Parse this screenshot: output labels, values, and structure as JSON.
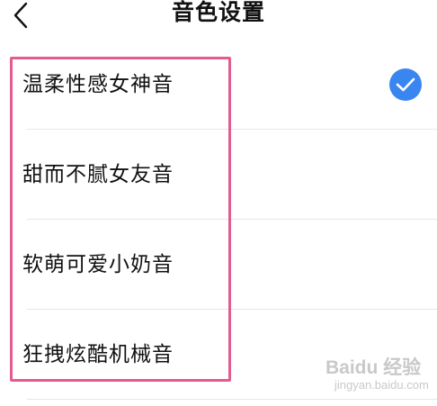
{
  "header": {
    "title": "音色设置"
  },
  "voices": [
    {
      "label": "温柔性感女神音",
      "selected": true
    },
    {
      "label": "甜而不腻女友音",
      "selected": false
    },
    {
      "label": "软萌可爱小奶音",
      "selected": false
    },
    {
      "label": "狂拽炫酷机械音",
      "selected": false
    }
  ],
  "colors": {
    "check": "#3a86f0",
    "highlight": "#e45c8f",
    "divider": "#e6e6e6"
  },
  "icons": {
    "back": "chevron-left-icon",
    "selected": "check-circle-icon"
  },
  "watermark": {
    "logo": "Baidu 经验",
    "url": "jingyan.baidu.com"
  }
}
